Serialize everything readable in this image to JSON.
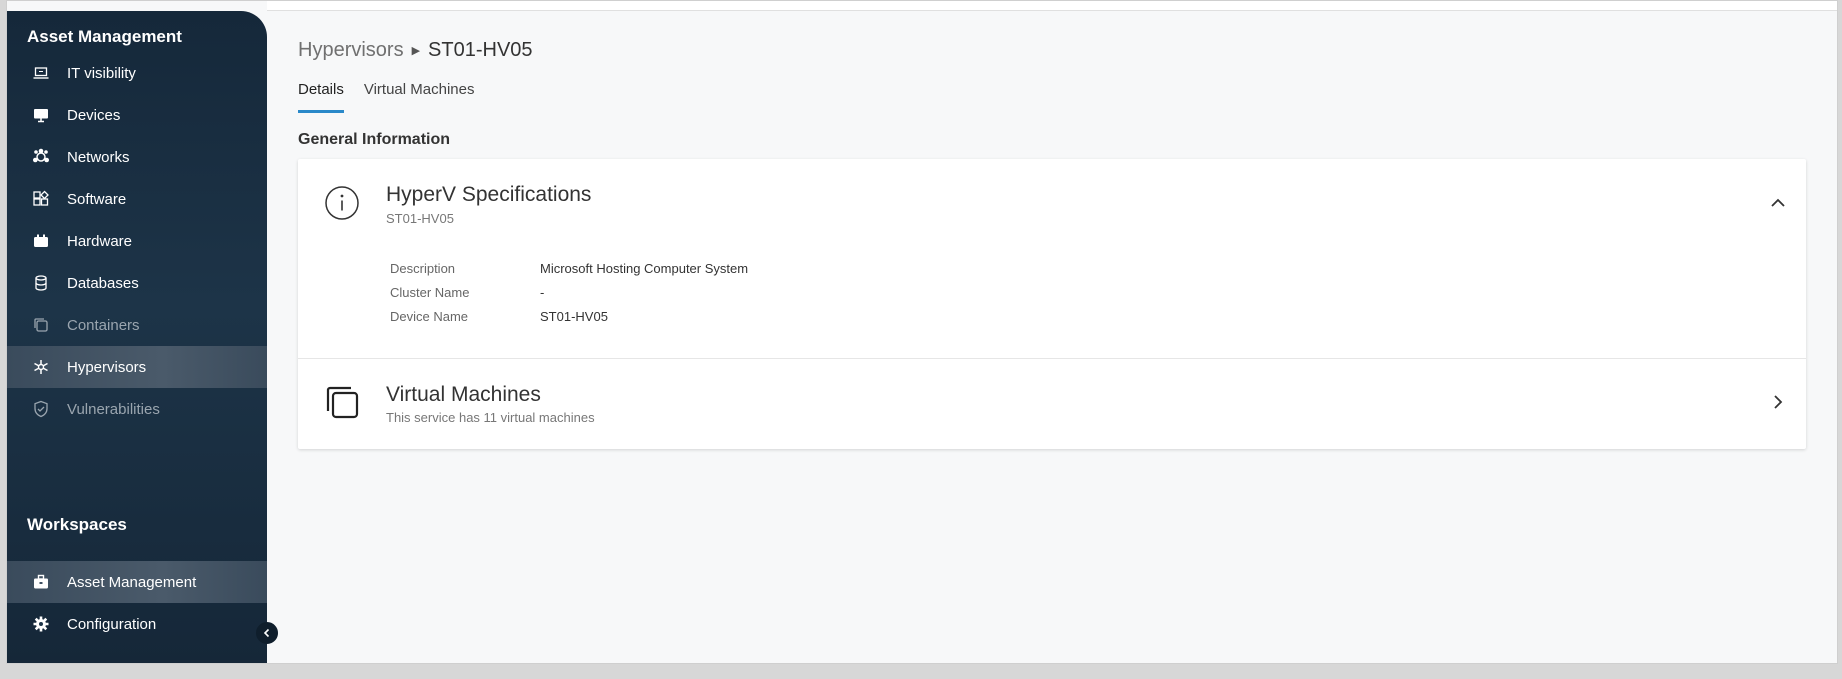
{
  "sidebar": {
    "section_heading": "Asset Management",
    "items": [
      {
        "label": "IT visibility",
        "icon": "laptop-icon"
      },
      {
        "label": "Devices",
        "icon": "monitor-icon"
      },
      {
        "label": "Networks",
        "icon": "network-icon"
      },
      {
        "label": "Software",
        "icon": "software-icon"
      },
      {
        "label": "Hardware",
        "icon": "hardware-icon"
      },
      {
        "label": "Databases",
        "icon": "database-icon"
      },
      {
        "label": "Containers",
        "icon": "container-icon"
      },
      {
        "label": "Hypervisors",
        "icon": "hypervisor-icon",
        "active": true
      },
      {
        "label": "Vulnerabilities",
        "icon": "shield-icon"
      }
    ],
    "workspaces_heading": "Workspaces",
    "workspace_items": [
      {
        "label": "Asset Management",
        "icon": "briefcase-icon",
        "active": true
      },
      {
        "label": "Configuration",
        "icon": "gear-icon"
      }
    ]
  },
  "breadcrumb": {
    "parent": "Hypervisors",
    "current": "ST01-HV05"
  },
  "tabs": [
    {
      "label": "Details",
      "active": true
    },
    {
      "label": "Virtual Machines"
    }
  ],
  "section_title": "General Information",
  "spec_card": {
    "title": "HyperV Specifications",
    "subtitle": "ST01-HV05",
    "rows": [
      {
        "label": "Description",
        "value": "Microsoft Hosting Computer System"
      },
      {
        "label": "Cluster Name",
        "value": "-"
      },
      {
        "label": "Device Name",
        "value": "ST01-HV05"
      }
    ]
  },
  "vm_card": {
    "title": "Virtual Machines",
    "subtitle": "This service has 11 virtual machines"
  },
  "colors": {
    "accent": "#2a89c9",
    "sidebar_bg": "#1d3448"
  }
}
